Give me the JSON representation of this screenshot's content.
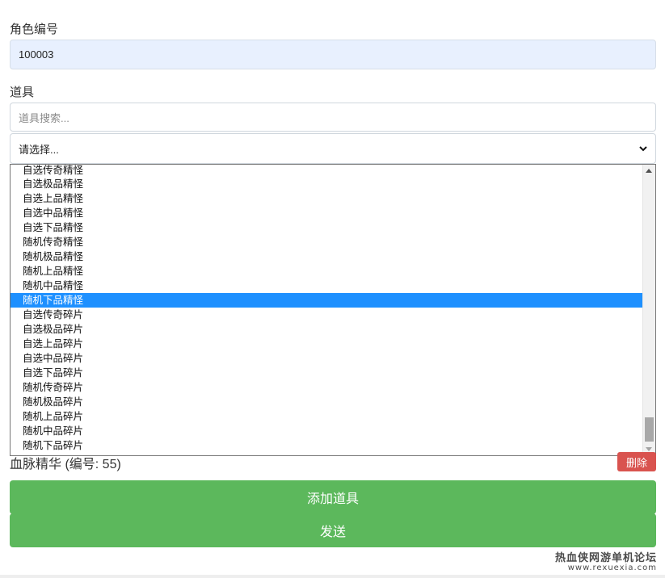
{
  "role": {
    "label": "角色编号",
    "value": "100003"
  },
  "item": {
    "label": "道具",
    "search_placeholder": "道具搜索...",
    "select_value": "请选择...",
    "options": [
      "自选传奇精怪",
      "自选极品精怪",
      "自选上品精怪",
      "自选中品精怪",
      "自选下品精怪",
      "随机传奇精怪",
      "随机极品精怪",
      "随机上品精怪",
      "随机中品精怪",
      "随机下品精怪",
      "自选传奇碎片",
      "自选极品碎片",
      "自选上品碎片",
      "自选中品碎片",
      "自选下品碎片",
      "随机传奇碎片",
      "随机极品碎片",
      "随机上品碎片",
      "随机中品碎片",
      "随机下品碎片"
    ],
    "highlighted_option": "随机下品精怪"
  },
  "added_item": {
    "text": "血脉精华 (编号: 55)",
    "delete_label": "删除"
  },
  "buttons": {
    "add_item": "添加道具",
    "send": "发送"
  },
  "watermark": {
    "line1": "热血侠网游单机论坛",
    "line2": "www.rexuexia.com"
  },
  "colors": {
    "highlight": "#1e90ff",
    "green_button": "#5cb85c",
    "delete_button": "#d9534f",
    "readonly_field": "#e8f0fe"
  }
}
